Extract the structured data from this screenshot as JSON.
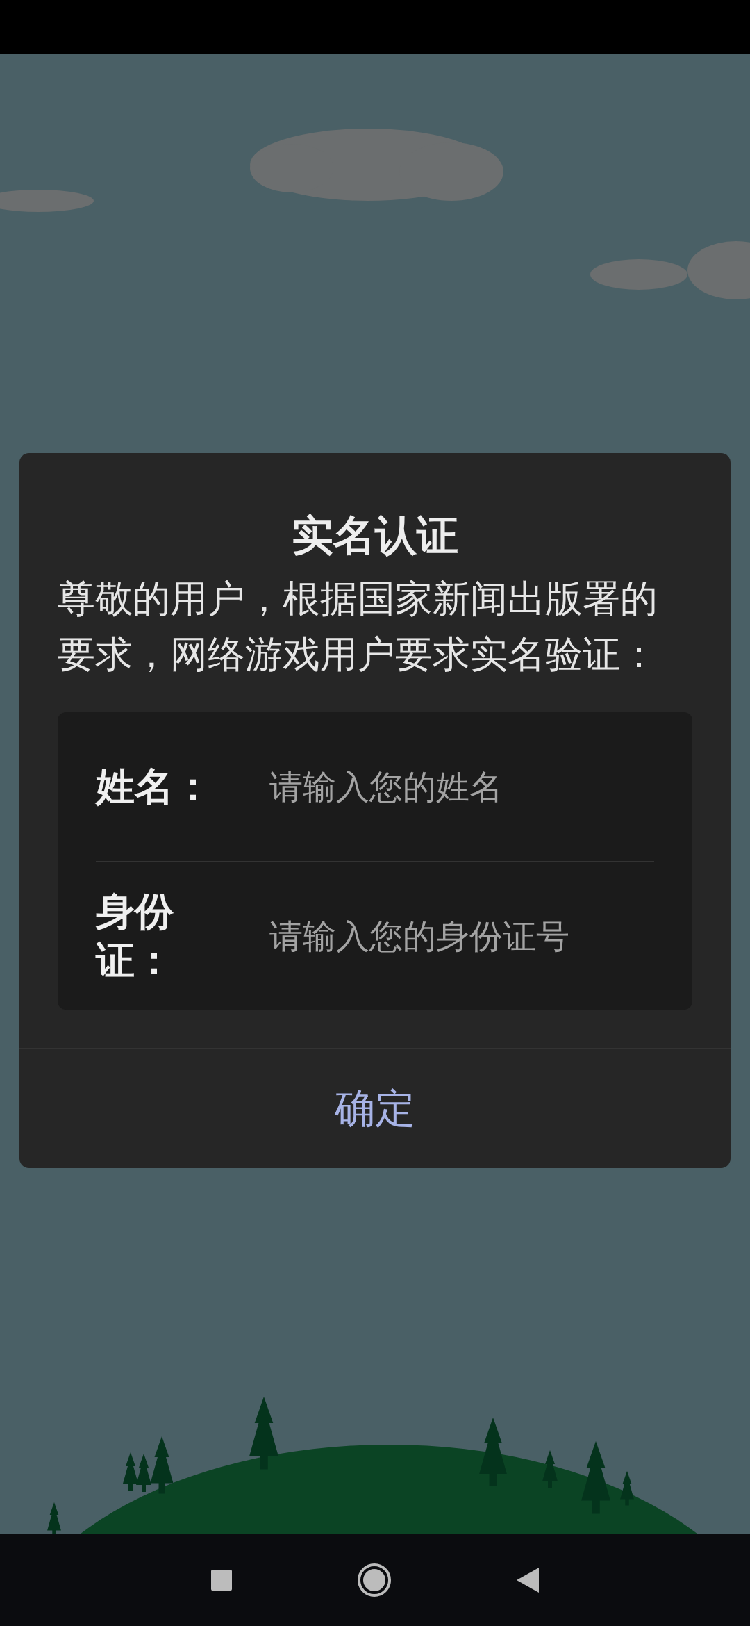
{
  "dialog": {
    "title": "实名认证",
    "message": "尊敬的用户，根据国家新闻出版署的要求，网络游戏用户要求实名验证：",
    "fields": [
      {
        "label": "姓名：",
        "placeholder": "请输入您的姓名"
      },
      {
        "label": "身份证：",
        "placeholder": "请输入您的身份证号"
      }
    ],
    "confirm_button": "确定"
  }
}
